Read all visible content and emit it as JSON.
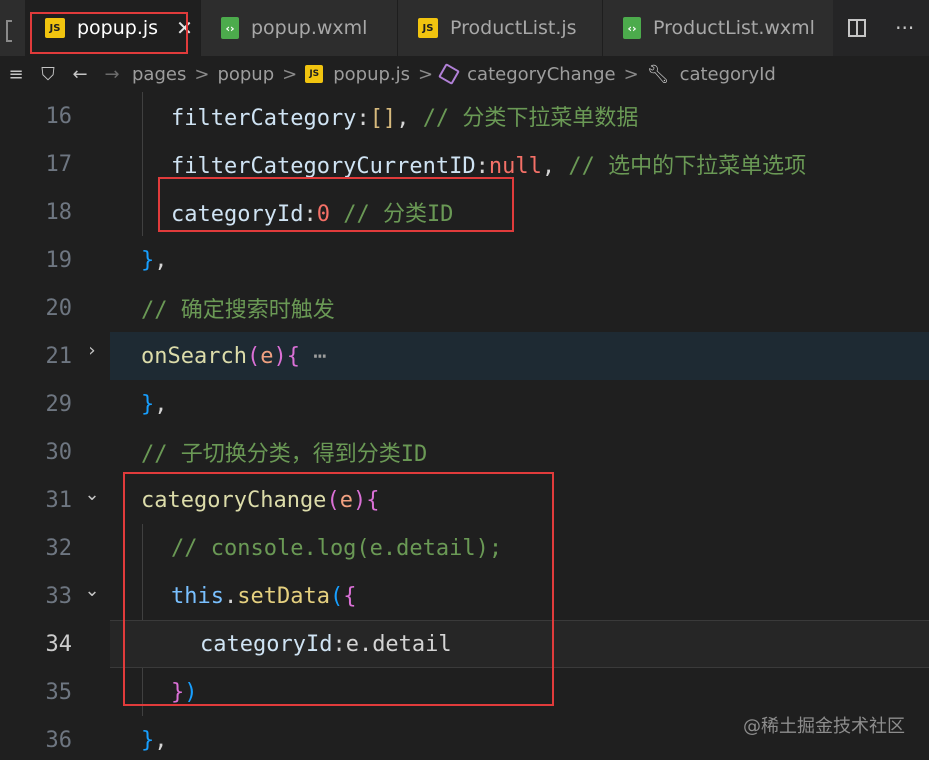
{
  "tabs": [
    {
      "label": "popup.js",
      "kind": "js",
      "badge": "JS",
      "active": true
    },
    {
      "label": "popup.wxml",
      "kind": "wxml",
      "active": false
    },
    {
      "label": "ProductList.js",
      "kind": "js",
      "badge": "JS",
      "active": false
    },
    {
      "label": "ProductList.wxml",
      "kind": "wxml",
      "active": false
    }
  ],
  "tab_actions": {
    "more": "···"
  },
  "breadcrumb": {
    "items": [
      "pages",
      "popup",
      "popup.js",
      "categoryChange",
      "categoryId"
    ],
    "separator": ">",
    "js_badge": "JS"
  },
  "code": {
    "lines": [
      {
        "num": "16",
        "tokens": [
          [
            "prop",
            "filterCategory"
          ],
          [
            "plain",
            ":"
          ],
          [
            "br1",
            "[]"
          ],
          [
            "plain",
            ", "
          ],
          [
            "com",
            "// 分类下拉菜单数据"
          ]
        ]
      },
      {
        "num": "17",
        "tokens": [
          [
            "prop",
            "filterCategoryCurrentID"
          ],
          [
            "plain",
            ":"
          ],
          [
            "null",
            "null"
          ],
          [
            "plain",
            ", "
          ],
          [
            "com",
            "// 选中的下拉菜单选项"
          ]
        ]
      },
      {
        "num": "18",
        "tokens": [
          [
            "prop",
            "categoryId"
          ],
          [
            "plain",
            ":"
          ],
          [
            "num",
            "0"
          ],
          [
            "plain",
            " "
          ],
          [
            "com",
            "// 分类ID"
          ]
        ]
      },
      {
        "num": "19",
        "tokens": [
          [
            "br3",
            "}"
          ],
          [
            "plain",
            ","
          ]
        ]
      },
      {
        "num": "20",
        "tokens": [
          [
            "com",
            "// 确定搜索时触发"
          ]
        ]
      },
      {
        "num": "21",
        "tokens": [
          [
            "fn",
            "onSearch"
          ],
          [
            "br2",
            "("
          ],
          [
            "param",
            "e"
          ],
          [
            "br2",
            ")"
          ],
          [
            "br2",
            "{"
          ],
          [
            "dots",
            " ⋯"
          ]
        ]
      },
      {
        "num": "29",
        "tokens": [
          [
            "br3",
            "}"
          ],
          [
            "plain",
            ","
          ]
        ]
      },
      {
        "num": "30",
        "tokens": [
          [
            "com",
            "// 子切换分类，得到分类ID"
          ]
        ]
      },
      {
        "num": "31",
        "tokens": [
          [
            "fn",
            "categoryChange"
          ],
          [
            "br2",
            "("
          ],
          [
            "param",
            "e"
          ],
          [
            "br2",
            ")"
          ],
          [
            "br2",
            "{"
          ]
        ]
      },
      {
        "num": "32",
        "tokens": [
          [
            "com",
            "// console.log(e.detail);"
          ]
        ]
      },
      {
        "num": "33",
        "tokens": [
          [
            "kw",
            "this"
          ],
          [
            "plain",
            "."
          ],
          [
            "fn2",
            "setData"
          ],
          [
            "br3",
            "("
          ],
          [
            "br2",
            "{"
          ]
        ]
      },
      {
        "num": "34",
        "tokens": [
          [
            "prop",
            "categoryId"
          ],
          [
            "plain",
            ":e.detail"
          ]
        ]
      },
      {
        "num": "35",
        "tokens": [
          [
            "br2",
            "}"
          ],
          [
            "br3",
            ")"
          ]
        ]
      },
      {
        "num": "36",
        "tokens": [
          [
            "br3",
            "}"
          ],
          [
            "plain",
            ","
          ]
        ]
      }
    ]
  },
  "watermark": "@稀土掘金技术社区",
  "colors": {
    "annotation_box": "#e03b3b",
    "comment": "#6a9955",
    "number": "#f47067",
    "function": "#dcdcaa",
    "keyword": "#79c0ff",
    "js_badge": "#f1c40f",
    "wxml_badge": "#4cab4c"
  }
}
